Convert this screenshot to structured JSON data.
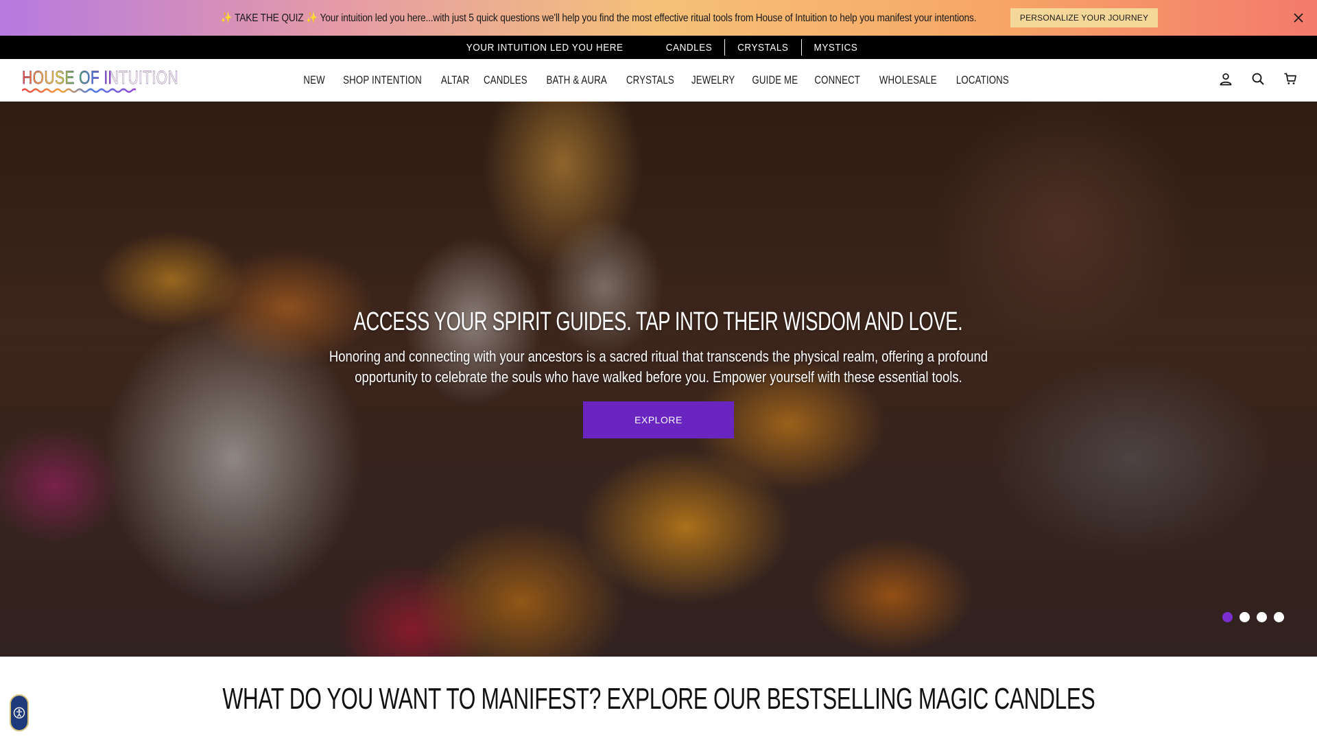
{
  "announcement": {
    "text": "✨ TAKE THE QUIZ ✨ Your intuition led you here...with just 5 quick questions we'll help you find the most effective ritual tools from House of Intuition to help you manifest your intentions.",
    "button_label": "PERSONALIZE YOUR JOURNEY",
    "close_icon": "close-icon"
  },
  "subnav": {
    "items": [
      "YOUR INTUITION LED YOU HERE",
      "CANDLES",
      "CRYSTALS",
      "MYSTICS"
    ]
  },
  "header": {
    "logo_text": "HOUSE OF INTUITION",
    "nav": [
      "NEW",
      "SHOP INTENTION",
      "ALTAR",
      "CANDLES",
      "BATH & AURA",
      "CRYSTALS",
      "JEWELRY",
      "GUIDE ME",
      "CONNECT",
      "WHOLESALE",
      "LOCATIONS"
    ],
    "icons": [
      "account-icon",
      "search-icon",
      "cart-icon"
    ]
  },
  "hero": {
    "title": "ACCESS YOUR SPIRIT GUIDES. TAP INTO THEIR WISDOM AND LOVE.",
    "description": "Honoring and connecting with your ancestors is a sacred ritual that transcends the physical realm, offering a profound opportunity to celebrate the souls who have walked before you. Empower yourself with these essential tools.",
    "button_label": "EXPLORE",
    "slides_total": 4,
    "active_slide": 1
  },
  "section": {
    "title": "WHAT DO YOU WANT TO MANIFEST? EXPLORE OUR BESTSELLING MAGIC CANDLES"
  },
  "colors": {
    "accent_purple": "#6a25c0",
    "dot_active": "#7a2ecf",
    "subnav_bg": "#000000"
  }
}
